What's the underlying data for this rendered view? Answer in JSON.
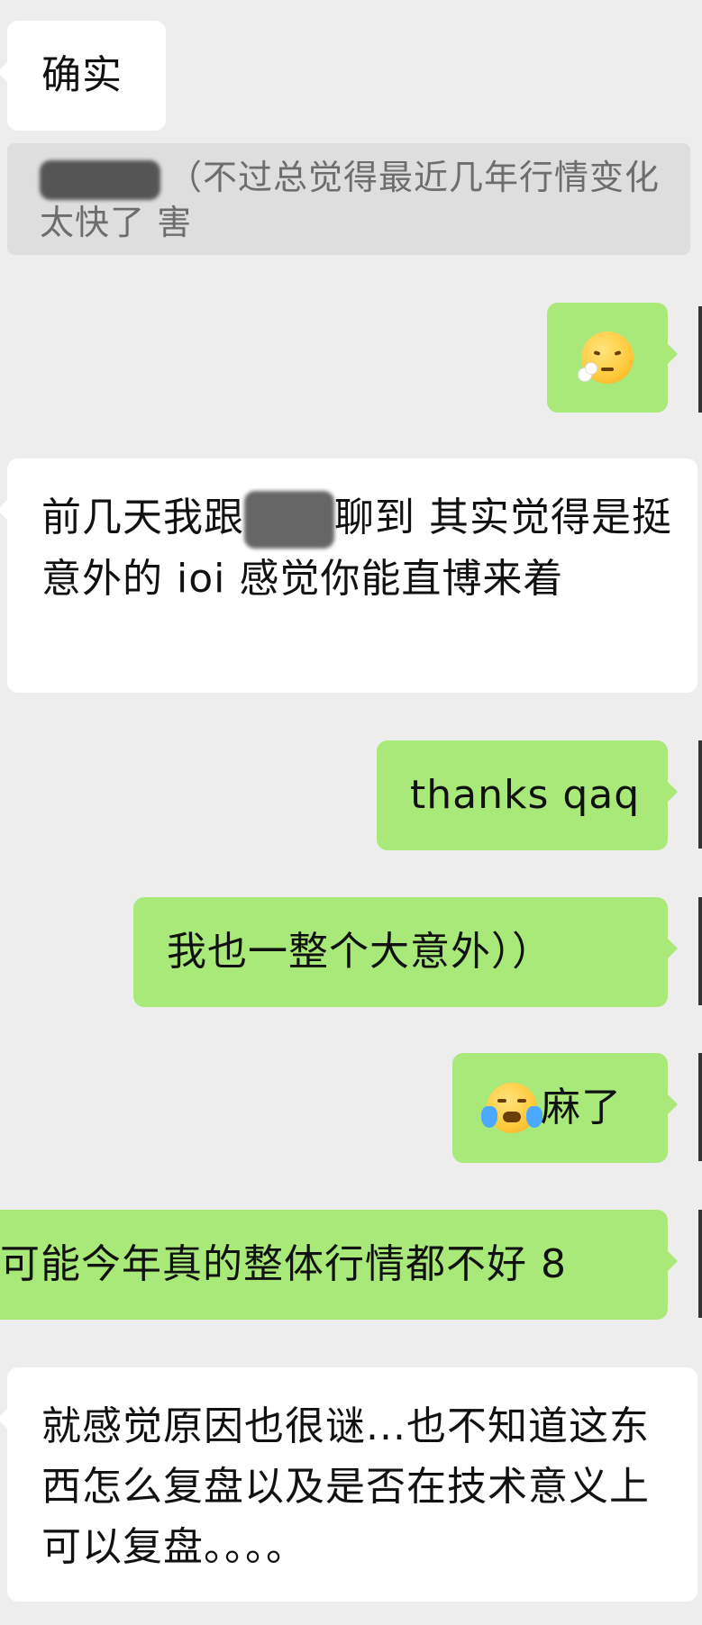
{
  "messages": {
    "m1": "确实",
    "quote_text": "（不过总觉得最近几年行情变化太快了 害",
    "m3_emoji": "exhale-face-emoji",
    "m4_part1": "前几天我跟",
    "m4_part2": "聊到 其实觉得是挺意外的 ioi 感觉你能直博来着",
    "m5": "thanks qaq",
    "m6": "我也一整个大意外））",
    "m7_emoji": "loudly-crying-face-emoji",
    "m7_text": "麻了",
    "m8": "可能今年真的整体行情都不好 8",
    "m9": "就感觉原因也很谜...也不知道这东西怎么复盘以及是否在技术意义上可以复盘。。。。"
  },
  "colors": {
    "background": "#ededed",
    "incoming_bubble": "#ffffff",
    "outgoing_bubble": "#a9e97a",
    "quote_bg": "#dedede",
    "quote_text": "#6d6d6d"
  }
}
